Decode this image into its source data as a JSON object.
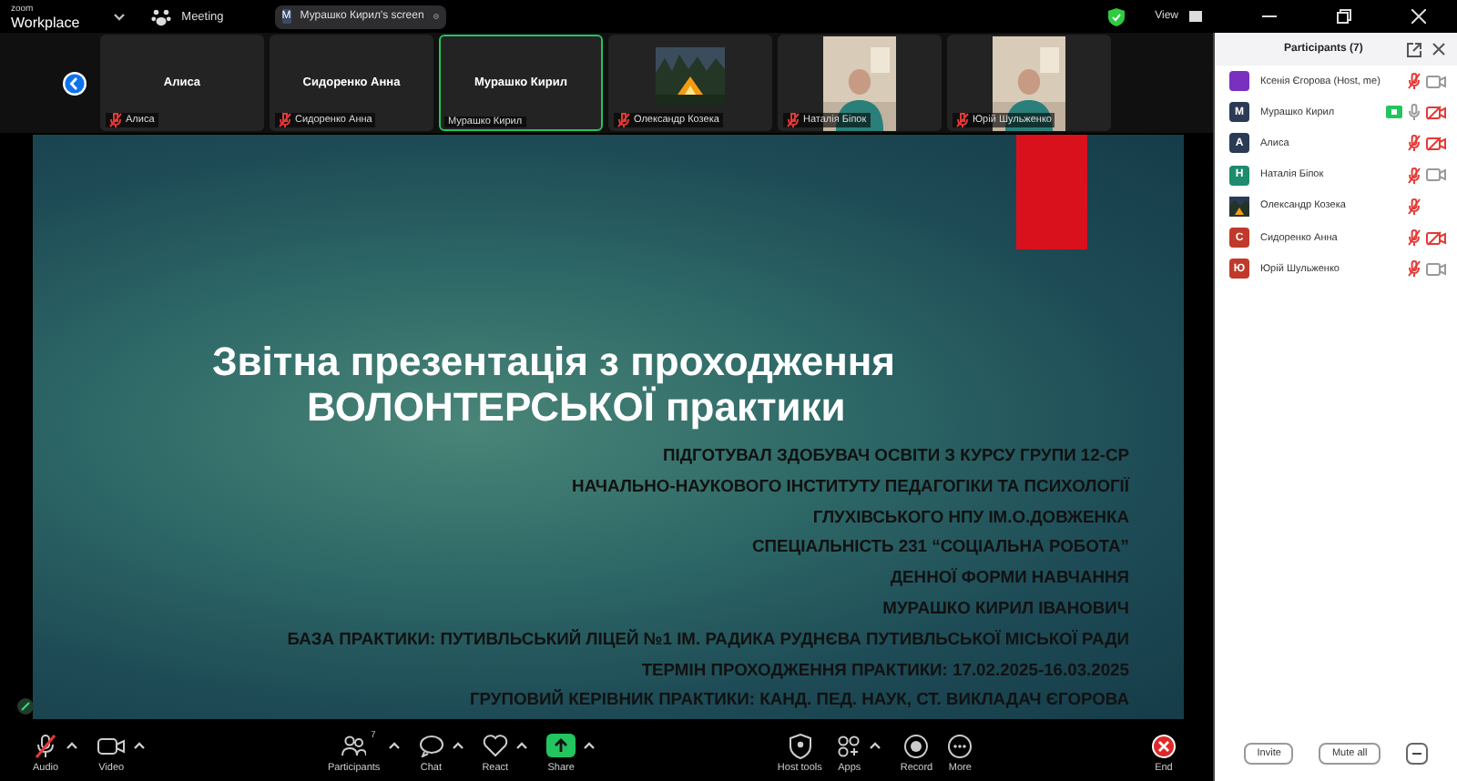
{
  "top_bar": {
    "app_name": "zoom",
    "app_subtitle": "Workplace",
    "meeting_label": "Meeting",
    "share_pill": {
      "avatar_letter": "M",
      "label": "Мурашко Кирил's screen"
    },
    "view_label": "View"
  },
  "video_strip": [
    {
      "kind": "name",
      "display_name": "Алиса",
      "label": "Алиса",
      "muted": true,
      "speaking": false
    },
    {
      "kind": "name",
      "display_name": "Сидоренко Анна",
      "label": "Сидоренко Анна",
      "muted": true,
      "speaking": false
    },
    {
      "kind": "name",
      "display_name": "Мурашко Кирил",
      "label": "Мурашко Кирил",
      "muted": false,
      "speaking": true
    },
    {
      "kind": "picture",
      "label": "Олександр Козека",
      "muted": true,
      "speaking": false
    },
    {
      "kind": "video",
      "label": "Наталія Біпок",
      "muted": true,
      "speaking": false
    },
    {
      "kind": "video",
      "label": "Юрій Шульженко",
      "muted": true,
      "speaking": false
    }
  ],
  "slide": {
    "title_lines": [
      "Звітна презентація з проходження",
      "ВОЛОНТЕРСЬКОЇ практики"
    ],
    "lines": [
      "ПІДГОТУВАЛ ЗДОБУВАЧ ОСВІТИ З КУРСУ ГРУПИ 12-СР",
      "НАЧАЛЬНО-НАУКОВОГО ІНСТИТУТУ ПЕДАГОГІКИ ТА ПСИХОЛОГІЇ",
      "ГЛУХІВСЬКОГО НПУ ІМ.О.ДОВЖЕНКА",
      "СПЕЦІАЛЬНІСТЬ 231 “СОЦІАЛЬНА РОБОТА”",
      "ДЕННОЇ ФОРМИ НАВЧАННЯ",
      "МУРАШКО КИРИЛ ІВАНОВИЧ",
      "БАЗА ПРАКТИКИ: ПУТИВЛЬСЬКИЙ ЛІЦЕЙ №1 ІМ. РАДИКА РУДНЄВА ПУТИВЛЬСЬКОЇ МІСЬКОЇ РАДИ",
      "ТЕРМІН ПРОХОДЖЕННЯ ПРАКТИКИ: 17.02.2025-16.03.2025",
      "ГРУПОВИЙ КЕРІВНИК ПРАКТИКИ: КАНД. ПЕД. НАУК, СТ. ВИКЛАДАЧ ЄГОРОВА"
    ]
  },
  "toolbar": [
    {
      "kind": "audio",
      "label": "Audio",
      "caret": true
    },
    {
      "kind": "video",
      "label": "Video",
      "caret": true
    },
    {
      "kind": "participants",
      "label": "Participants",
      "badge": "7",
      "caret": true
    },
    {
      "kind": "chat",
      "label": "Chat",
      "caret": true
    },
    {
      "kind": "react",
      "label": "React",
      "caret": true
    },
    {
      "kind": "share",
      "label": "Share",
      "caret": true
    },
    {
      "kind": "host",
      "label": "Host tools",
      "caret": false
    },
    {
      "kind": "apps",
      "label": "Apps",
      "caret": true
    },
    {
      "kind": "record",
      "label": "Record",
      "caret": false
    },
    {
      "kind": "more",
      "label": "More",
      "caret": false
    },
    {
      "kind": "end",
      "label": "End",
      "caret": false
    }
  ],
  "participants_panel": {
    "title": "Participants (7)",
    "participants": [
      {
        "kind": "plain",
        "name": "Ксенія Єгорова (Host, me)",
        "color": "#7b2fbe",
        "muted": true,
        "sharing": false,
        "camera": true,
        "camera_blocked": false
      },
      {
        "kind": "letter",
        "name": "Мурашко Кирил",
        "letter": "M",
        "color": "#2b3a55",
        "muted": false,
        "sharing": true,
        "camera": true,
        "camera_blocked": true
      },
      {
        "kind": "letter",
        "name": "Алиса",
        "letter": "A",
        "color": "#2b3a55",
        "muted": true,
        "sharing": false,
        "camera": true,
        "camera_blocked": true
      },
      {
        "kind": "letter",
        "name": "Наталія Біпок",
        "letter": "Н",
        "color": "#1e8a6e",
        "muted": true,
        "sharing": false,
        "camera": true,
        "camera_blocked": false
      },
      {
        "kind": "picture",
        "name": "Олександр Козека",
        "muted": true,
        "sharing": false,
        "camera": false
      },
      {
        "kind": "letter",
        "name": "Сидоренко Анна",
        "letter": "С",
        "color": "#c0392b",
        "muted": true,
        "sharing": false,
        "camera": true,
        "camera_blocked": true
      },
      {
        "kind": "letter",
        "name": "Юрій Шульженко",
        "letter": "Ю",
        "color": "#c0392b",
        "muted": true,
        "sharing": false,
        "camera": true,
        "camera_blocked": false
      }
    ],
    "buttons": [
      "Invite",
      "Mute all"
    ]
  }
}
